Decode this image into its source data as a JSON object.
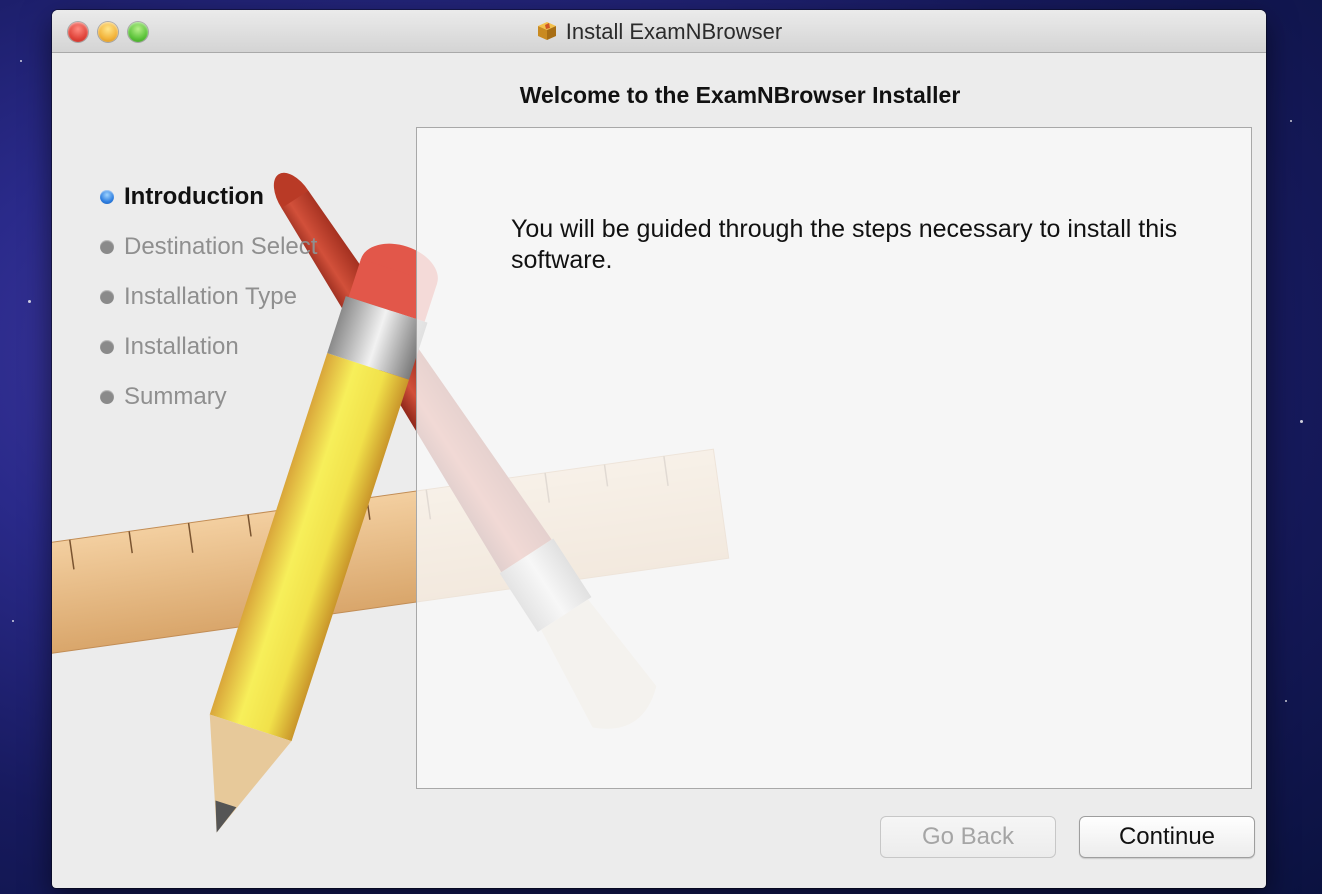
{
  "window": {
    "title": "Install ExamNBrowser",
    "heading": "Welcome to the ExamNBrowser Installer"
  },
  "steps": [
    {
      "label": "Introduction",
      "active": true
    },
    {
      "label": "Destination Select",
      "active": false
    },
    {
      "label": "Installation Type",
      "active": false
    },
    {
      "label": "Installation",
      "active": false
    },
    {
      "label": "Summary",
      "active": false
    }
  ],
  "content": {
    "message": "You will be guided through the steps necessary to install this software."
  },
  "buttons": {
    "go_back": "Go Back",
    "continue": "Continue"
  },
  "colors": {
    "active_bullet": "#2f7fe0",
    "inactive_bullet": "#8a8a8a"
  }
}
